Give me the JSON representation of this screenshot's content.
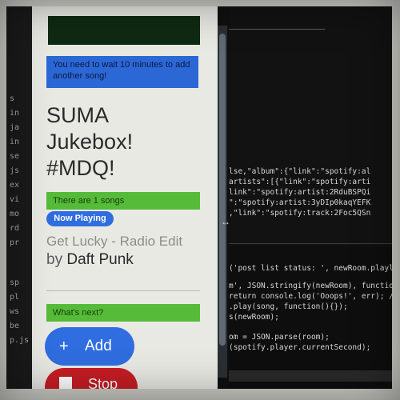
{
  "app": {
    "message_notice": "You need to wait 10 minutes to add another song!",
    "title_line1": "SUMA",
    "title_line2": "Jukebox!",
    "title_line3": "#MDQ!",
    "song_count": "There are 1 songs",
    "now_playing_label": "Now Playing",
    "current_song": "Get Lucky - Radio Edit",
    "by_label": "by",
    "current_artist": "Daft Punk",
    "whats_next": "What's next?",
    "add_button": "Add",
    "stop_button": "Stop"
  },
  "code_editor": {
    "top_lines": [
      "lse,\"album\":{\"link\":\"spotify:al",
      "artists\":[{\"link\":\"spotify:arti",
      "link\":\"spotify:artist:2RduBSPQi",
      "\":\"spotify:artist:3yDIp0kaqYEFK",
      ",\"link\":\"spotify:track:2Foc5QSn"
    ],
    "console_lines": [
      "('post list status: ', newRoom.playlist);",
      "m', JSON.stringify(newRoom), function (err",
      "return console.log('Ooops!', err); //",
      ".play(song, function(){});",
      "s(newRoom);",
      "",
      "om = JSON.parse(room);",
      "(spotify.player.currentSecond);"
    ]
  }
}
